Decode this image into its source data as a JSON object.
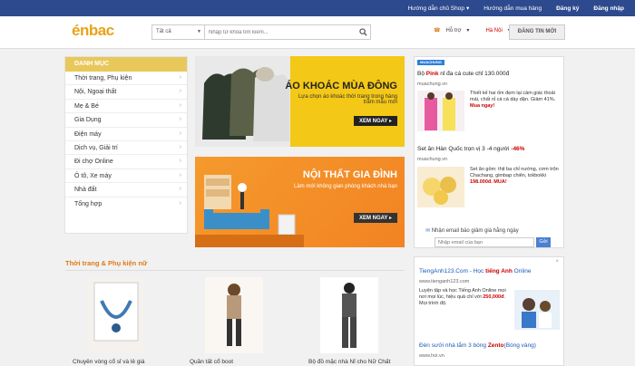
{
  "topbar": {
    "links": [
      "Hướng dẫn chủ Shop",
      "Hướng dẫn mua hàng",
      "Đăng ký",
      "Đăng nhập"
    ]
  },
  "header": {
    "logo": "énbac",
    "search_category": "Tất cả",
    "search_placeholder": "Nhập từ khóa tìm kiếm...",
    "help": "Hỗ trợ",
    "location": "Hà Nội",
    "post_button": "ĐĂNG TIN MỚI"
  },
  "sidebar": {
    "title": "DANH MỤC",
    "items": [
      "Thời trang, Phụ kiện",
      "Nội, Ngoại thất",
      "Mẹ & Bé",
      "Gia Dụng",
      "Điện máy",
      "Dịch vụ, Giải trí",
      "Đi chợ Online",
      "Ô tô, Xe máy",
      "Nhà đất",
      "Tổng hợp"
    ]
  },
  "banners": [
    {
      "title": "ÁO KHOÁC MÙA ĐÔNG",
      "subtitle": "Lựa chọn áo khoác thời trang trong hàng trăm mẫu mới",
      "button": "XEM NGAY"
    },
    {
      "title": "NỘI THẤT GIA ĐÌNH",
      "subtitle": "Làm mới không gian phòng khách nhà bạn",
      "button": "XEM NGAY"
    }
  ],
  "section": {
    "title": "Thời trang & Phụ kiện nữ",
    "products": [
      {
        "caption": "Chuyên vòng cổ sỉ và lẻ giá"
      },
      {
        "caption": "Quần tất cổ boot"
      },
      {
        "caption": "Bộ đồ mặc nhà Nỉ cho Nữ Chất"
      }
    ]
  },
  "deals": {
    "brand": "MUACHUNG",
    "items": [
      {
        "title_a": "Bộ ",
        "title_hl": "Pink",
        "title_b": " nỉ đa cá cute chỉ 130.000đ",
        "source": "muachung.vn",
        "desc_a": "Thiết kế hai ốm đẹm lại cảm giác thoải mái, chất nỉ cá cá dày dặn. Giảm 41%. ",
        "desc_hl": "Mua ngay!"
      },
      {
        "title_a": "Set ăn Hàn Quốc trọn vị 3 -4 người ",
        "title_hl": "-46%",
        "title_b": "",
        "source": "muachung.vn",
        "desc_a": "Set ăn gồm: thịt ba chỉ nướng, cơm trộn Chachang, gimbap chiên, tokbokki ",
        "desc_hl": "198.000đ. MUA!"
      }
    ],
    "newsletter_label": "Nhận email báo giảm giá hằng ngày",
    "newsletter_placeholder": "Nhập email của bạn",
    "newsletter_button": "Gửi"
  },
  "ads": {
    "close": "×",
    "ad1_title_a": "TiengAnh123.Com - Học ",
    "ad1_title_hl": "tiếng Anh",
    "ad1_title_b": " Online",
    "ad1_source": "www.tienganh123.com",
    "ad1_desc_a": "Luyện tập và học Tiếng Anh Online mọi nơi mọi lúc, hiệu quả chỉ với ",
    "ad1_desc_hl": "250,000đ",
    "ad1_desc_b": ". Mọi trình độ.",
    "ad2_title_a": "Đèn sưởi nhà tắm 3 bóng ",
    "ad2_title_hl": "Zento",
    "ad2_title_b": "(Bóng vàng)",
    "ad2_source": "www.hoi.vn"
  },
  "colors": {
    "topbar": "#2d4a8e",
    "accent": "#e8a317",
    "category_header": "#e8c85a",
    "banner2": "#f28322"
  }
}
